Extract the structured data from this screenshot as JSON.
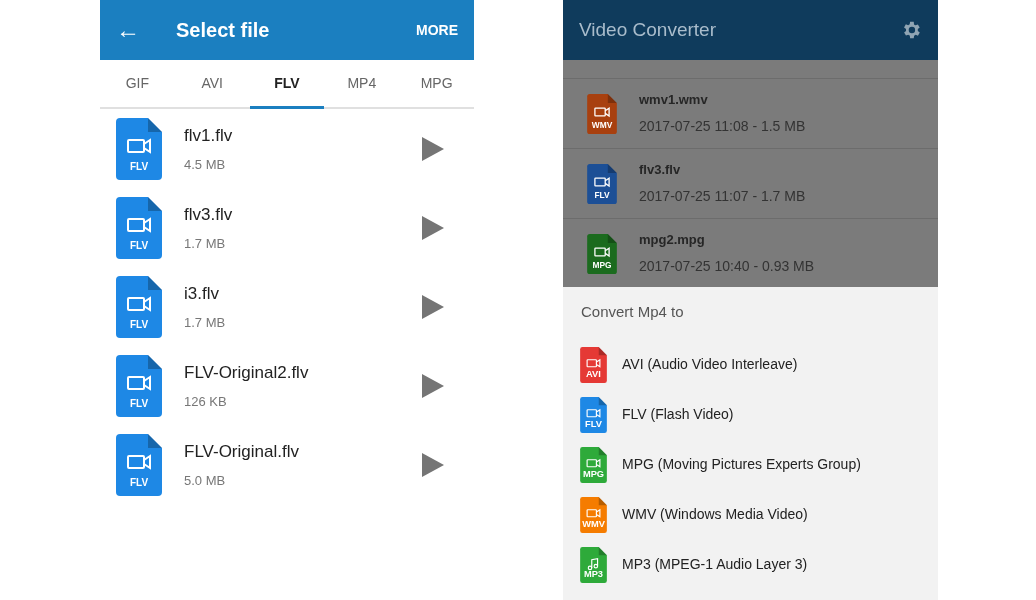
{
  "left_screen": {
    "app_bar": {
      "title": "Select file",
      "back": "←",
      "action": "MORE"
    },
    "tabs": [
      {
        "label": "GIF",
        "selected": false
      },
      {
        "label": "AVI",
        "selected": false
      },
      {
        "label": "FLV",
        "selected": true
      },
      {
        "label": "MP4",
        "selected": false
      },
      {
        "label": "MPG",
        "selected": false
      }
    ],
    "files": [
      {
        "name": "flv1.flv",
        "size": "4.5 MB",
        "icon_label": "FLV",
        "color": "#1e88e5"
      },
      {
        "name": "flv3.flv",
        "size": "1.7 MB",
        "icon_label": "FLV",
        "color": "#1e88e5"
      },
      {
        "name": "i3.flv",
        "size": "1.7 MB",
        "icon_label": "FLV",
        "color": "#1e88e5"
      },
      {
        "name": "FLV-Original2.flv",
        "size": "126 KB",
        "icon_label": "FLV",
        "color": "#1e88e5"
      },
      {
        "name": "FLV-Original.flv",
        "size": "5.0 MB",
        "icon_label": "FLV",
        "color": "#1e88e5"
      }
    ]
  },
  "right_screen": {
    "app_bar": {
      "title": "Video Converter"
    },
    "files": [
      {
        "name": "wmv1.wmv",
        "details": "2017-07-25 11:08 - 1.5 MB",
        "icon_label": "WMV",
        "color": "#a8400f"
      },
      {
        "name": "flv3.flv",
        "details": "2017-07-25 11:07 - 1.7 MB",
        "icon_label": "FLV",
        "color": "#1c4f96"
      },
      {
        "name": "mpg2.mpg",
        "details": "2017-07-25 10:40 - 0.93 MB",
        "icon_label": "MPG",
        "color": "#1b6b1e"
      }
    ],
    "sheet": {
      "title": "Convert Mp4 to",
      "options": [
        {
          "label": "AVI (Audio Video Interleave)",
          "icon_label": "AVI",
          "color": "#e53935",
          "kind": "video"
        },
        {
          "label": "FLV (Flash Video)",
          "icon_label": "FLV",
          "color": "#1e88e5",
          "kind": "video"
        },
        {
          "label": "MPG (Moving Pictures Experts Group)",
          "icon_label": "MPG",
          "color": "#2eaa3a",
          "kind": "video"
        },
        {
          "label": "WMV (Windows Media Video)",
          "icon_label": "WMV",
          "color": "#f57c00",
          "kind": "video"
        },
        {
          "label": "MP3 (MPEG-1 Audio Layer 3)",
          "icon_label": "MP3",
          "color": "#2eaa3a",
          "kind": "audio"
        }
      ]
    }
  }
}
